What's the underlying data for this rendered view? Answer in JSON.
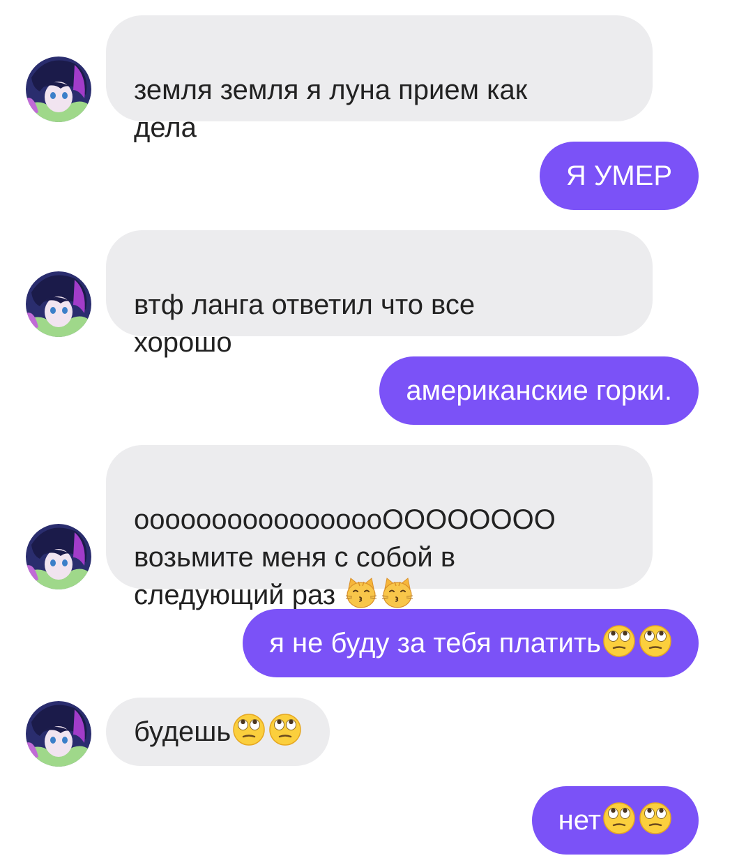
{
  "colors": {
    "incoming_bubble": "#ececee",
    "outgoing_bubble": "#7b52f7",
    "incoming_text": "#222222",
    "outgoing_text": "#ffffff"
  },
  "messages": [
    {
      "direction": "incoming",
      "text": "земля земля я луна прием как\nдела",
      "emoji": []
    },
    {
      "direction": "outgoing",
      "text": "Я УМЕР",
      "emoji": []
    },
    {
      "direction": "incoming",
      "text": "втф ланга ответил что все\nхорошо",
      "emoji": []
    },
    {
      "direction": "outgoing",
      "text": "американские горки.",
      "emoji": []
    },
    {
      "direction": "incoming",
      "text": "ооооооооооооооооОООООООО\nвозьмите меня с собой в\nследующий раз ",
      "emoji": [
        "kissing-cat-emoji",
        "kissing-cat-emoji"
      ]
    },
    {
      "direction": "outgoing",
      "text": "я не буду за тебя платить",
      "emoji": [
        "eye-roll-emoji",
        "eye-roll-emoji"
      ]
    },
    {
      "direction": "incoming",
      "text": "будешь",
      "emoji": [
        "eye-roll-emoji",
        "eye-roll-emoji"
      ]
    },
    {
      "direction": "outgoing",
      "text": "нет",
      "emoji": [
        "eye-roll-emoji",
        "eye-roll-emoji"
      ]
    }
  ]
}
